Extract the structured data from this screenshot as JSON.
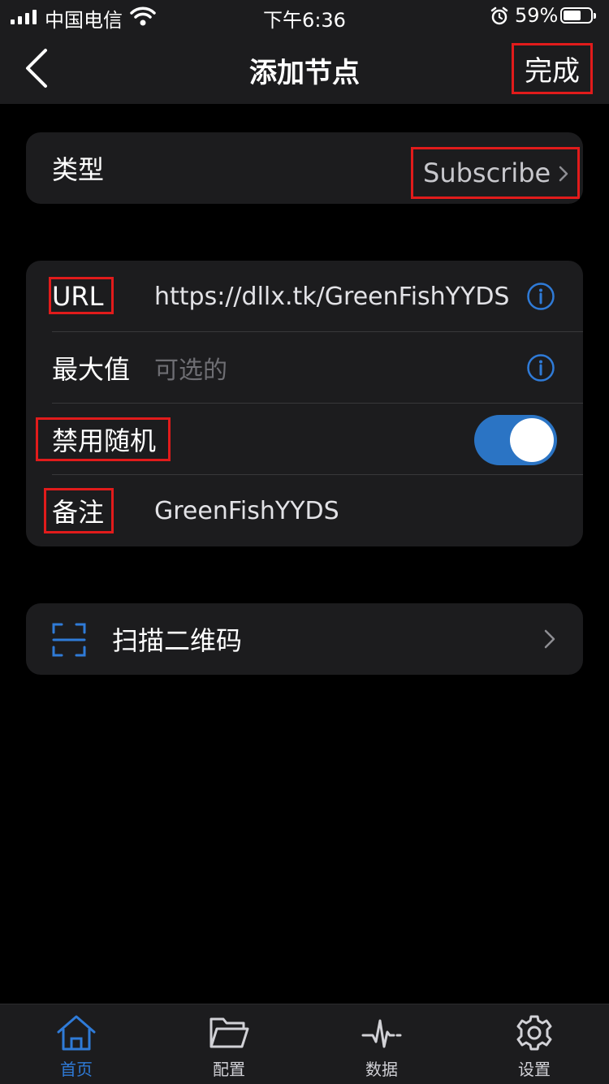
{
  "status": {
    "carrier": "中国电信",
    "time": "下午6:36",
    "battery": "59%",
    "battery_level": 0.59
  },
  "nav": {
    "title": "添加节点",
    "done_label": "完成"
  },
  "type_row": {
    "label": "类型",
    "value": "Subscribe"
  },
  "form": {
    "url_label": "URL",
    "url_value": "https://dllx.tk/GreenFishYYDS",
    "max_label": "最大值",
    "max_placeholder": "可选的",
    "disable_random_label": "禁用随机",
    "disable_random_on": true,
    "remark_label": "备注",
    "remark_value": "GreenFishYYDS"
  },
  "scan": {
    "label": "扫描二维码"
  },
  "tabs": [
    {
      "label": "首页",
      "icon": "home-icon",
      "active": true
    },
    {
      "label": "配置",
      "icon": "folder-icon",
      "active": false
    },
    {
      "label": "数据",
      "icon": "activity-icon",
      "active": false
    },
    {
      "label": "设置",
      "icon": "gear-icon",
      "active": false
    }
  ],
  "colors": {
    "accent": "#2f7bd8",
    "toggle_on": "#2b74c4",
    "highlight_box": "#e11b1b"
  }
}
